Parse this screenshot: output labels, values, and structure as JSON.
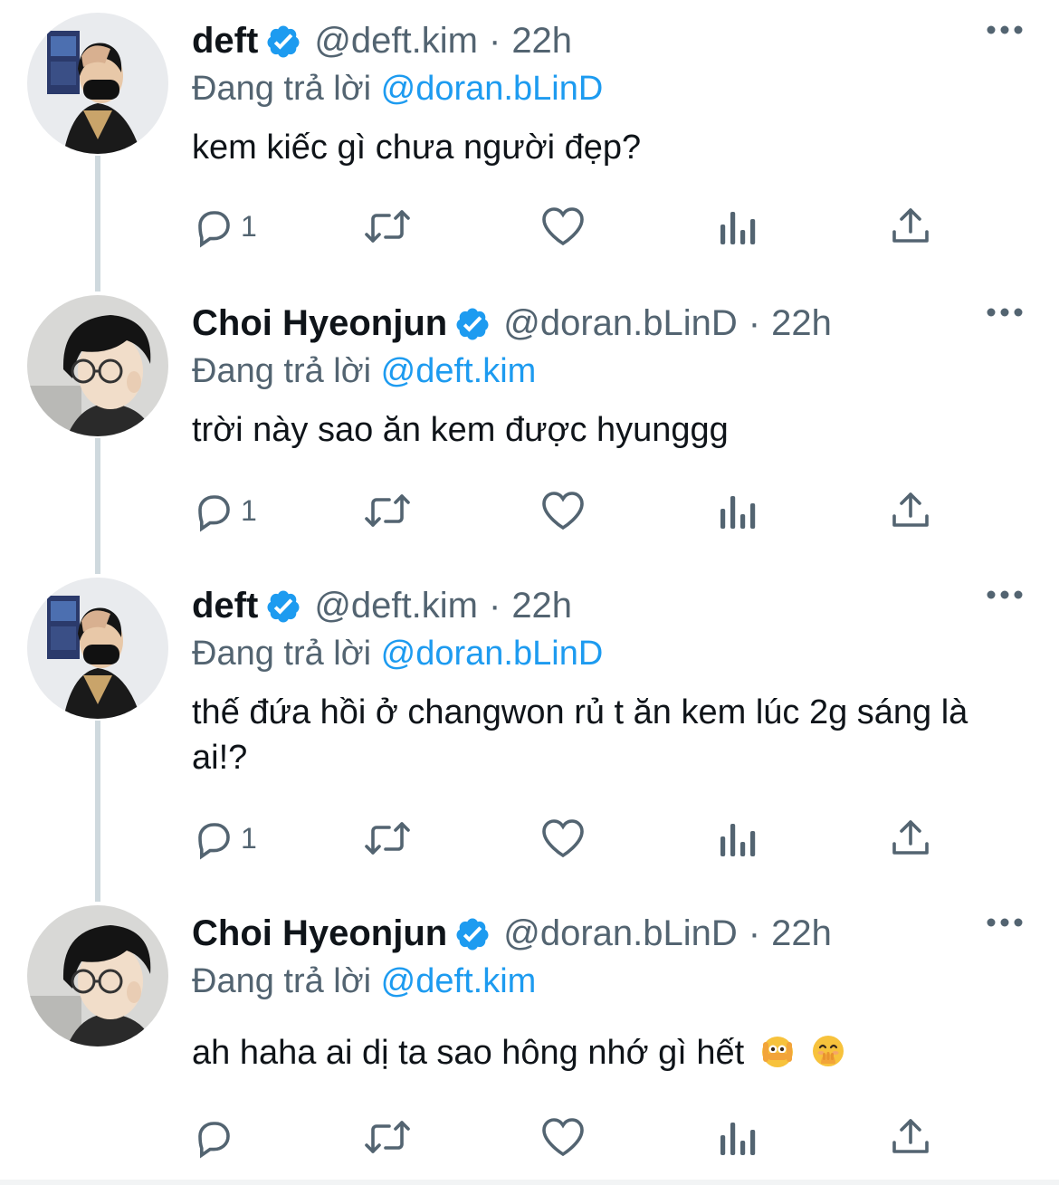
{
  "tweets": [
    {
      "name": "deft",
      "handle": "@deft.kim",
      "dot": "·",
      "time": "22h",
      "reply_prefix": "Đang trả lời",
      "reply_to": "@doran.bLinD",
      "text": "kem kiếc gì chưa người đẹp?",
      "reply_count": "1",
      "avatar": "deft-avatar"
    },
    {
      "name": "Choi Hyeonjun",
      "handle": "@doran.bLinD",
      "dot": "·",
      "time": "22h",
      "reply_prefix": "Đang trả lời",
      "reply_to": "@deft.kim",
      "text": "trời này sao ăn kem được hyunggg",
      "reply_count": "1",
      "avatar": "doran-avatar"
    },
    {
      "name": "deft",
      "handle": "@deft.kim",
      "dot": "·",
      "time": "22h",
      "reply_prefix": "Đang trả lời",
      "reply_to": "@doran.bLinD",
      "text": "thế đứa hồi ở changwon rủ t ăn kem lúc 2g sáng là ai!?",
      "reply_count": "1",
      "avatar": "deft-avatar"
    },
    {
      "name": "Choi Hyeonjun",
      "handle": "@doran.bLinD",
      "dot": "·",
      "time": "22h",
      "reply_prefix": "Đang trả lời",
      "reply_to": "@deft.kim",
      "text": "ah haha ai dị ta sao hông nhớ gì hết",
      "emojis": [
        "face-with-peeking-eye",
        "face-with-hand-over-mouth"
      ],
      "reply_count": "",
      "avatar": "doran-avatar"
    }
  ],
  "icons": {
    "verified": "verified-badge-icon",
    "more": "more-icon",
    "reply": "reply-icon",
    "retweet": "retweet-icon",
    "like": "like-icon",
    "views": "views-icon",
    "share": "share-icon"
  },
  "colors": {
    "accent": "#1d9bf0",
    "secondary_text": "#536471",
    "primary_text": "#0f1419",
    "thread_line": "#cfd9de"
  }
}
